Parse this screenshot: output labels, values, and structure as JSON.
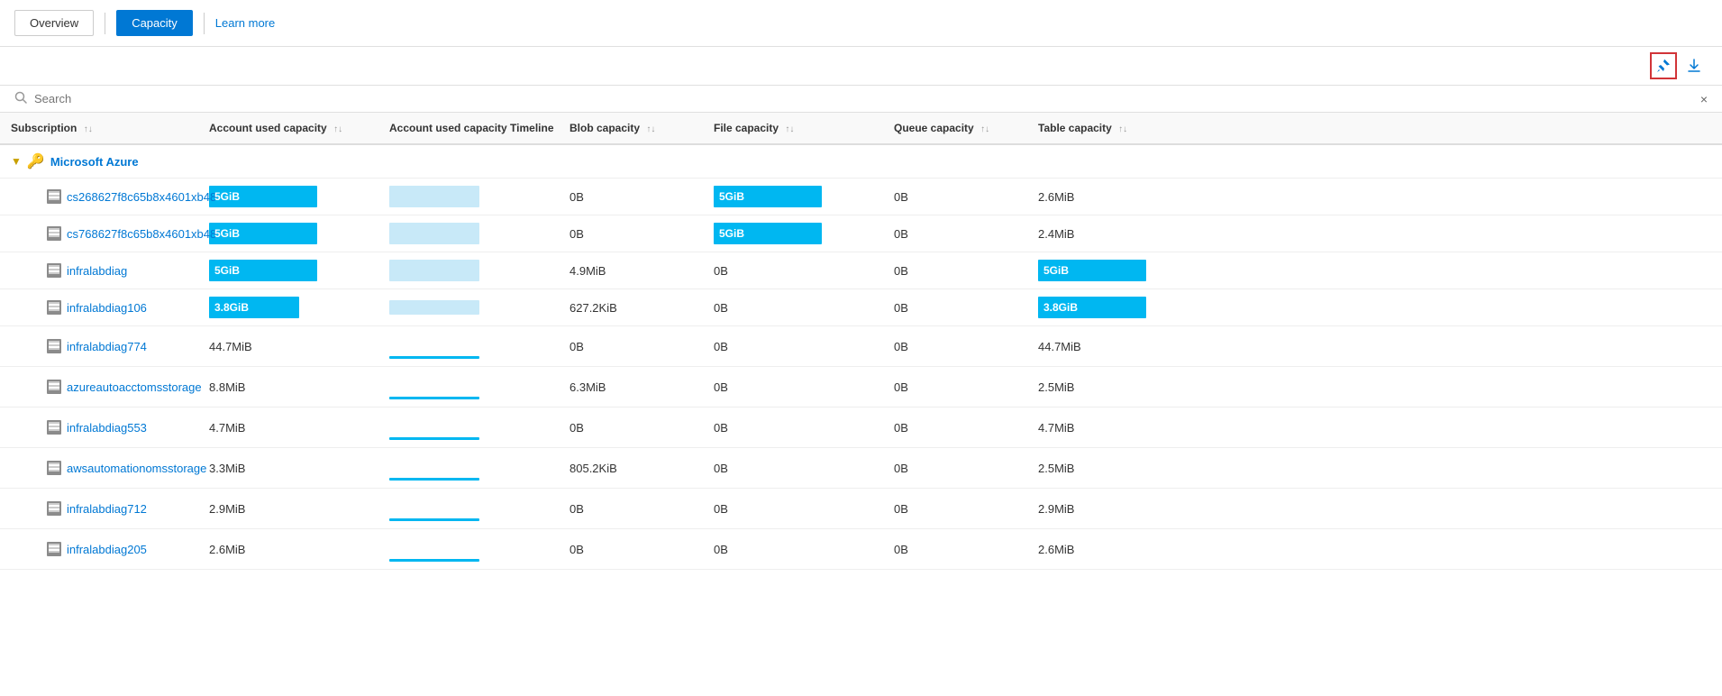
{
  "nav": {
    "overview_label": "Overview",
    "capacity_label": "Capacity",
    "learn_more_label": "Learn more"
  },
  "toolbar": {
    "pin_tooltip": "Pin to dashboard",
    "download_tooltip": "Download"
  },
  "search": {
    "placeholder": "Search",
    "clear_label": "×"
  },
  "table": {
    "columns": [
      {
        "id": "subscription",
        "label": "Subscription"
      },
      {
        "id": "account_used_cap",
        "label": "Account used capacity"
      },
      {
        "id": "account_used_timeline",
        "label": "Account used capacity Timeline"
      },
      {
        "id": "blob_cap",
        "label": "Blob capacity"
      },
      {
        "id": "file_cap",
        "label": "File capacity"
      },
      {
        "id": "queue_cap",
        "label": "Queue capacity"
      },
      {
        "id": "table_cap",
        "label": "Table capacity"
      }
    ],
    "group": {
      "name": "Microsoft Azure"
    },
    "rows": [
      {
        "subscription": "cs268627f8c65b8x4601xb48",
        "account_used_cap": "5GiB",
        "account_used_cap_type": "full_blue",
        "timeline_type": "full_light",
        "blob_cap": "0B",
        "file_cap": "5GiB",
        "file_cap_type": "full_blue",
        "queue_cap": "0B",
        "table_cap": "2.6MiB",
        "table_cap_type": "text"
      },
      {
        "subscription": "cs768627f8c65b8x4601xb48",
        "account_used_cap": "5GiB",
        "account_used_cap_type": "full_blue",
        "timeline_type": "full_light",
        "blob_cap": "0B",
        "file_cap": "5GiB",
        "file_cap_type": "full_blue",
        "queue_cap": "0B",
        "table_cap": "2.4MiB",
        "table_cap_type": "text"
      },
      {
        "subscription": "infralabdiag",
        "account_used_cap": "5GiB",
        "account_used_cap_type": "full_blue",
        "timeline_type": "full_light",
        "blob_cap": "4.9MiB",
        "file_cap": "0B",
        "file_cap_type": "text",
        "queue_cap": "0B",
        "table_cap": "5GiB",
        "table_cap_type": "full_blue"
      },
      {
        "subscription": "infralabdiag106",
        "account_used_cap": "3.8GiB",
        "account_used_cap_type": "full_blue_partial",
        "timeline_type": "partial_light",
        "blob_cap": "627.2KiB",
        "file_cap": "0B",
        "file_cap_type": "text",
        "queue_cap": "0B",
        "table_cap": "3.8GiB",
        "table_cap_type": "full_blue"
      },
      {
        "subscription": "infralabdiag774",
        "account_used_cap": "44.7MiB",
        "account_used_cap_type": "text",
        "timeline_type": "line",
        "blob_cap": "0B",
        "file_cap": "0B",
        "file_cap_type": "text",
        "queue_cap": "0B",
        "table_cap": "44.7MiB",
        "table_cap_type": "text"
      },
      {
        "subscription": "azureautoacctomsstorage",
        "account_used_cap": "8.8MiB",
        "account_used_cap_type": "text",
        "timeline_type": "line",
        "blob_cap": "6.3MiB",
        "file_cap": "0B",
        "file_cap_type": "text",
        "queue_cap": "0B",
        "table_cap": "2.5MiB",
        "table_cap_type": "text"
      },
      {
        "subscription": "infralabdiag553",
        "account_used_cap": "4.7MiB",
        "account_used_cap_type": "text",
        "timeline_type": "line",
        "blob_cap": "0B",
        "file_cap": "0B",
        "file_cap_type": "text",
        "queue_cap": "0B",
        "table_cap": "4.7MiB",
        "table_cap_type": "text"
      },
      {
        "subscription": "awsautomationomsstorage",
        "account_used_cap": "3.3MiB",
        "account_used_cap_type": "text",
        "timeline_type": "line",
        "blob_cap": "805.2KiB",
        "file_cap": "0B",
        "file_cap_type": "text",
        "queue_cap": "0B",
        "table_cap": "2.5MiB",
        "table_cap_type": "text"
      },
      {
        "subscription": "infralabdiag712",
        "account_used_cap": "2.9MiB",
        "account_used_cap_type": "text",
        "timeline_type": "line",
        "blob_cap": "0B",
        "file_cap": "0B",
        "file_cap_type": "text",
        "queue_cap": "0B",
        "table_cap": "2.9MiB",
        "table_cap_type": "text"
      },
      {
        "subscription": "infralabdiag205",
        "account_used_cap": "2.6MiB",
        "account_used_cap_type": "text",
        "timeline_type": "line",
        "blob_cap": "0B",
        "file_cap": "0B",
        "file_cap_type": "text",
        "queue_cap": "0B",
        "table_cap": "2.6MiB",
        "table_cap_type": "text"
      }
    ]
  },
  "colors": {
    "blue_bar": "#00b7f1",
    "light_blue_bar": "#c8e9f8",
    "accent": "#0078d4"
  }
}
